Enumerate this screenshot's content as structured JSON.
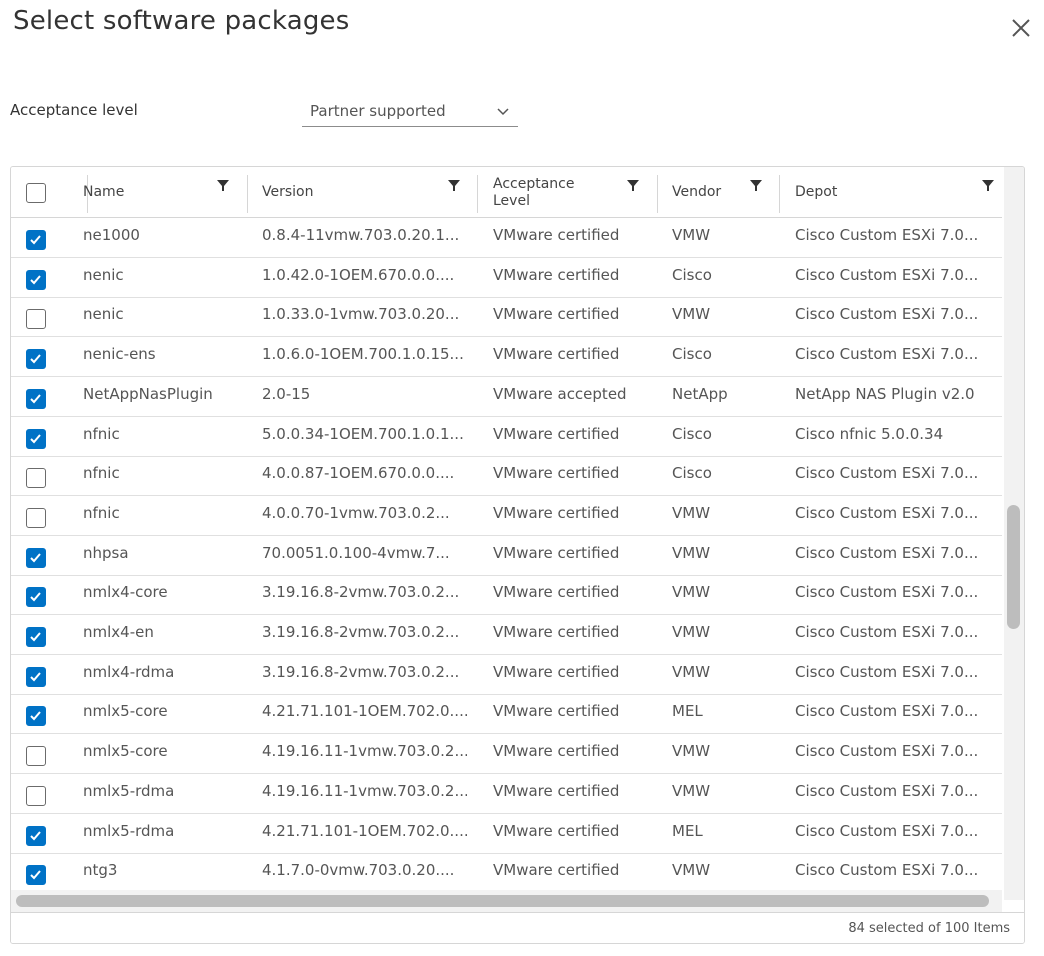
{
  "dialog": {
    "title": "Select software packages",
    "close_icon": "close-icon"
  },
  "acceptance": {
    "label": "Acceptance level",
    "selected": "Partner supported",
    "icon": "chevron-down-icon"
  },
  "table": {
    "columns": [
      {
        "key": "name",
        "label": "Name"
      },
      {
        "key": "version",
        "label": "Version"
      },
      {
        "key": "acceptance",
        "label": "Acceptance Level"
      },
      {
        "key": "vendor",
        "label": "Vendor"
      },
      {
        "key": "depot",
        "label": "Depot"
      }
    ],
    "header_checkbox_checked": false,
    "accent_color": "#0072c6",
    "rows": [
      {
        "checked": true,
        "name": "ne1000",
        "version": "0.8.4-11vmw.703.0.20.1...",
        "acceptance": "VMware certified",
        "vendor": "VMW",
        "depot": "Cisco Custom ESXi 7.0..."
      },
      {
        "checked": true,
        "name": "nenic",
        "version": "1.0.42.0-1OEM.670.0.0....",
        "acceptance": "VMware certified",
        "vendor": "Cisco",
        "depot": "Cisco Custom ESXi 7.0..."
      },
      {
        "checked": false,
        "name": "nenic",
        "version": "1.0.33.0-1vmw.703.0.20...",
        "acceptance": "VMware certified",
        "vendor": "VMW",
        "depot": "Cisco Custom ESXi 7.0..."
      },
      {
        "checked": true,
        "name": "nenic-ens",
        "version": "1.0.6.0-1OEM.700.1.0.15...",
        "acceptance": "VMware certified",
        "vendor": "Cisco",
        "depot": "Cisco Custom ESXi 7.0..."
      },
      {
        "checked": true,
        "name": "NetAppNasPlugin",
        "version": "2.0-15",
        "acceptance": "VMware accepted",
        "vendor": "NetApp",
        "depot": "NetApp NAS Plugin v2.0"
      },
      {
        "checked": true,
        "name": "nfnic",
        "version": "5.0.0.34-1OEM.700.1.0.1...",
        "acceptance": "VMware certified",
        "vendor": "Cisco",
        "depot": "Cisco nfnic 5.0.0.34"
      },
      {
        "checked": false,
        "name": "nfnic",
        "version": "4.0.0.87-1OEM.670.0.0....",
        "acceptance": "VMware certified",
        "vendor": "Cisco",
        "depot": "Cisco Custom ESXi 7.0..."
      },
      {
        "checked": false,
        "name": "nfnic",
        "version": "4.0.0.70-1vmw.703.0.2...",
        "acceptance": "VMware certified",
        "vendor": "VMW",
        "depot": "Cisco Custom ESXi 7.0..."
      },
      {
        "checked": true,
        "name": "nhpsa",
        "version": "70.0051.0.100-4vmw.7...",
        "acceptance": "VMware certified",
        "vendor": "VMW",
        "depot": "Cisco Custom ESXi 7.0..."
      },
      {
        "checked": true,
        "name": "nmlx4-core",
        "version": "3.19.16.8-2vmw.703.0.2...",
        "acceptance": "VMware certified",
        "vendor": "VMW",
        "depot": "Cisco Custom ESXi 7.0..."
      },
      {
        "checked": true,
        "name": "nmlx4-en",
        "version": "3.19.16.8-2vmw.703.0.2...",
        "acceptance": "VMware certified",
        "vendor": "VMW",
        "depot": "Cisco Custom ESXi 7.0..."
      },
      {
        "checked": true,
        "name": "nmlx4-rdma",
        "version": "3.19.16.8-2vmw.703.0.2...",
        "acceptance": "VMware certified",
        "vendor": "VMW",
        "depot": "Cisco Custom ESXi 7.0..."
      },
      {
        "checked": true,
        "name": "nmlx5-core",
        "version": "4.21.71.101-1OEM.702.0....",
        "acceptance": "VMware certified",
        "vendor": "MEL",
        "depot": "Cisco Custom ESXi 7.0..."
      },
      {
        "checked": false,
        "name": "nmlx5-core",
        "version": "4.19.16.11-1vmw.703.0.2...",
        "acceptance": "VMware certified",
        "vendor": "VMW",
        "depot": "Cisco Custom ESXi 7.0..."
      },
      {
        "checked": false,
        "name": "nmlx5-rdma",
        "version": "4.19.16.11-1vmw.703.0.2...",
        "acceptance": "VMware certified",
        "vendor": "VMW",
        "depot": "Cisco Custom ESXi 7.0..."
      },
      {
        "checked": true,
        "name": "nmlx5-rdma",
        "version": "4.21.71.101-1OEM.702.0....",
        "acceptance": "VMware certified",
        "vendor": "MEL",
        "depot": "Cisco Custom ESXi 7.0..."
      },
      {
        "checked": true,
        "name": "ntg3",
        "version": "4.1.7.0-0vmw.703.0.20....",
        "acceptance": "VMware certified",
        "vendor": "VMW",
        "depot": "Cisco Custom ESXi 7.0..."
      }
    ],
    "footer": "84 selected of 100 Items"
  }
}
